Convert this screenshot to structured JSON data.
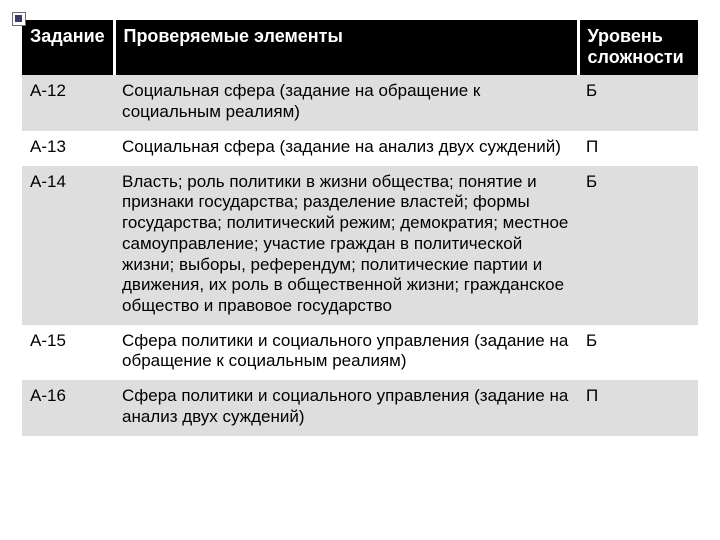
{
  "headers": {
    "task": "Задание",
    "elements": "Проверяемые элементы",
    "level": "Уровень сложности"
  },
  "rows": [
    {
      "task": "А-12",
      "elements": "Социальная сфера (задание на обращение к социальным реалиям)",
      "level": "Б"
    },
    {
      "task": "А-13",
      "elements": "Социальная сфера (задание на анализ двух суждений)",
      "level": "П"
    },
    {
      "task": "А-14",
      "elements": "Власть; роль политики в жизни общества; понятие и признаки государства; разделение властей; формы государства; политический режим; демократия; местное самоуправление; участие граждан в политической жизни; выборы, референдум; политические партии и движения, их роль в общественной жизни; гражданское общество и правовое государство",
      "level": "Б"
    },
    {
      "task": "А-15",
      "elements": "Сфера политики и социального управления (задание на обращение к социальным реалиям)",
      "level": "Б"
    },
    {
      "task": "А-16",
      "elements": "Сфера политики и социального управления (задание на анализ двух суждений)",
      "level": "П"
    }
  ]
}
